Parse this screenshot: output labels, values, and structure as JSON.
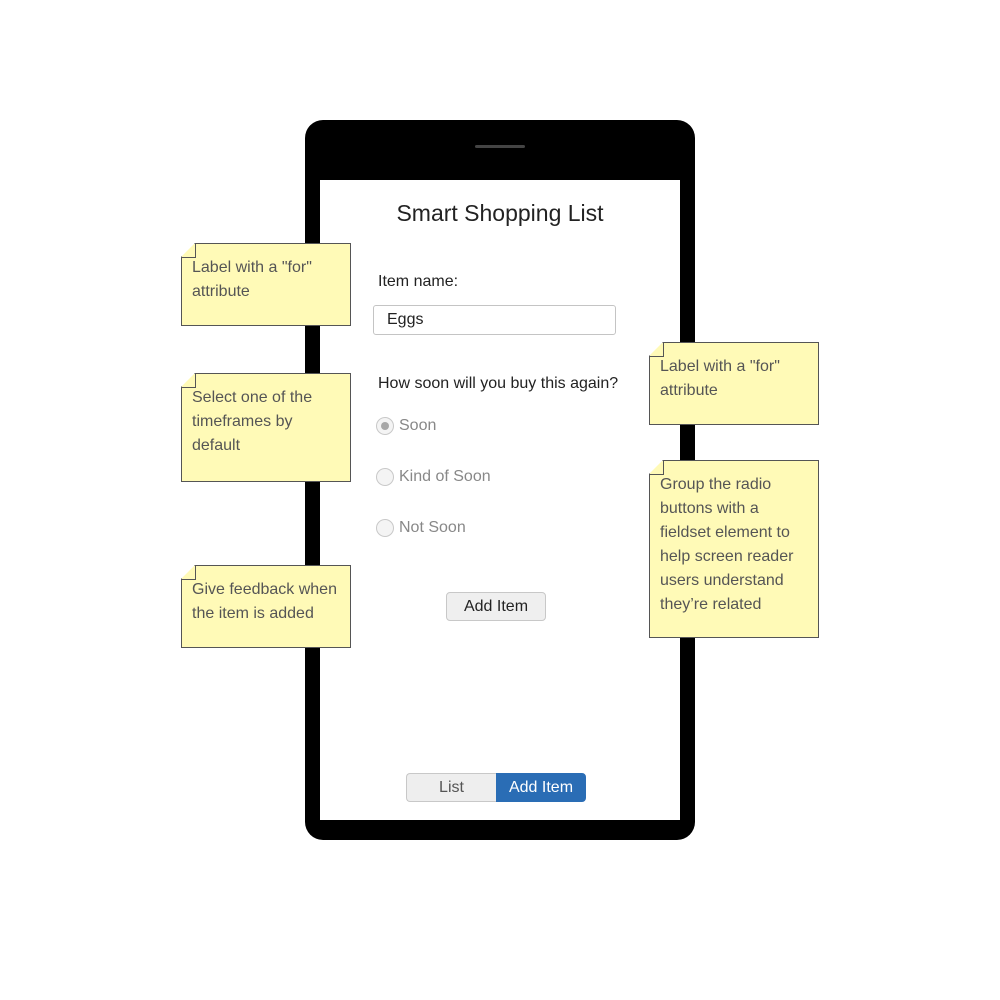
{
  "app": {
    "title": "Smart Shopping List"
  },
  "form": {
    "item_label": "Item name:",
    "item_value": "Eggs",
    "question": "How soon will you buy this again?",
    "options": [
      {
        "label": "Soon",
        "checked": true
      },
      {
        "label": "Kind of Soon",
        "checked": false
      },
      {
        "label": "Not Soon",
        "checked": false
      }
    ],
    "submit_label": "Add Item"
  },
  "nav": {
    "list_label": "List",
    "add_label": "Add Item",
    "active": "Add Item",
    "active_color": "#2a6db5"
  },
  "notes": [
    {
      "text": "Label with a \"for\" attribute"
    },
    {
      "text": "Select one of the timeframes by default"
    },
    {
      "text": "Give feedback when the item is added"
    },
    {
      "text": "Label with a \"for\" attribute"
    },
    {
      "text": "Group the radio buttons with a fieldset element to help screen reader users understand they’re related"
    }
  ],
  "colors": {
    "note_background": "#fffab7",
    "phone_frame": "#000000"
  }
}
